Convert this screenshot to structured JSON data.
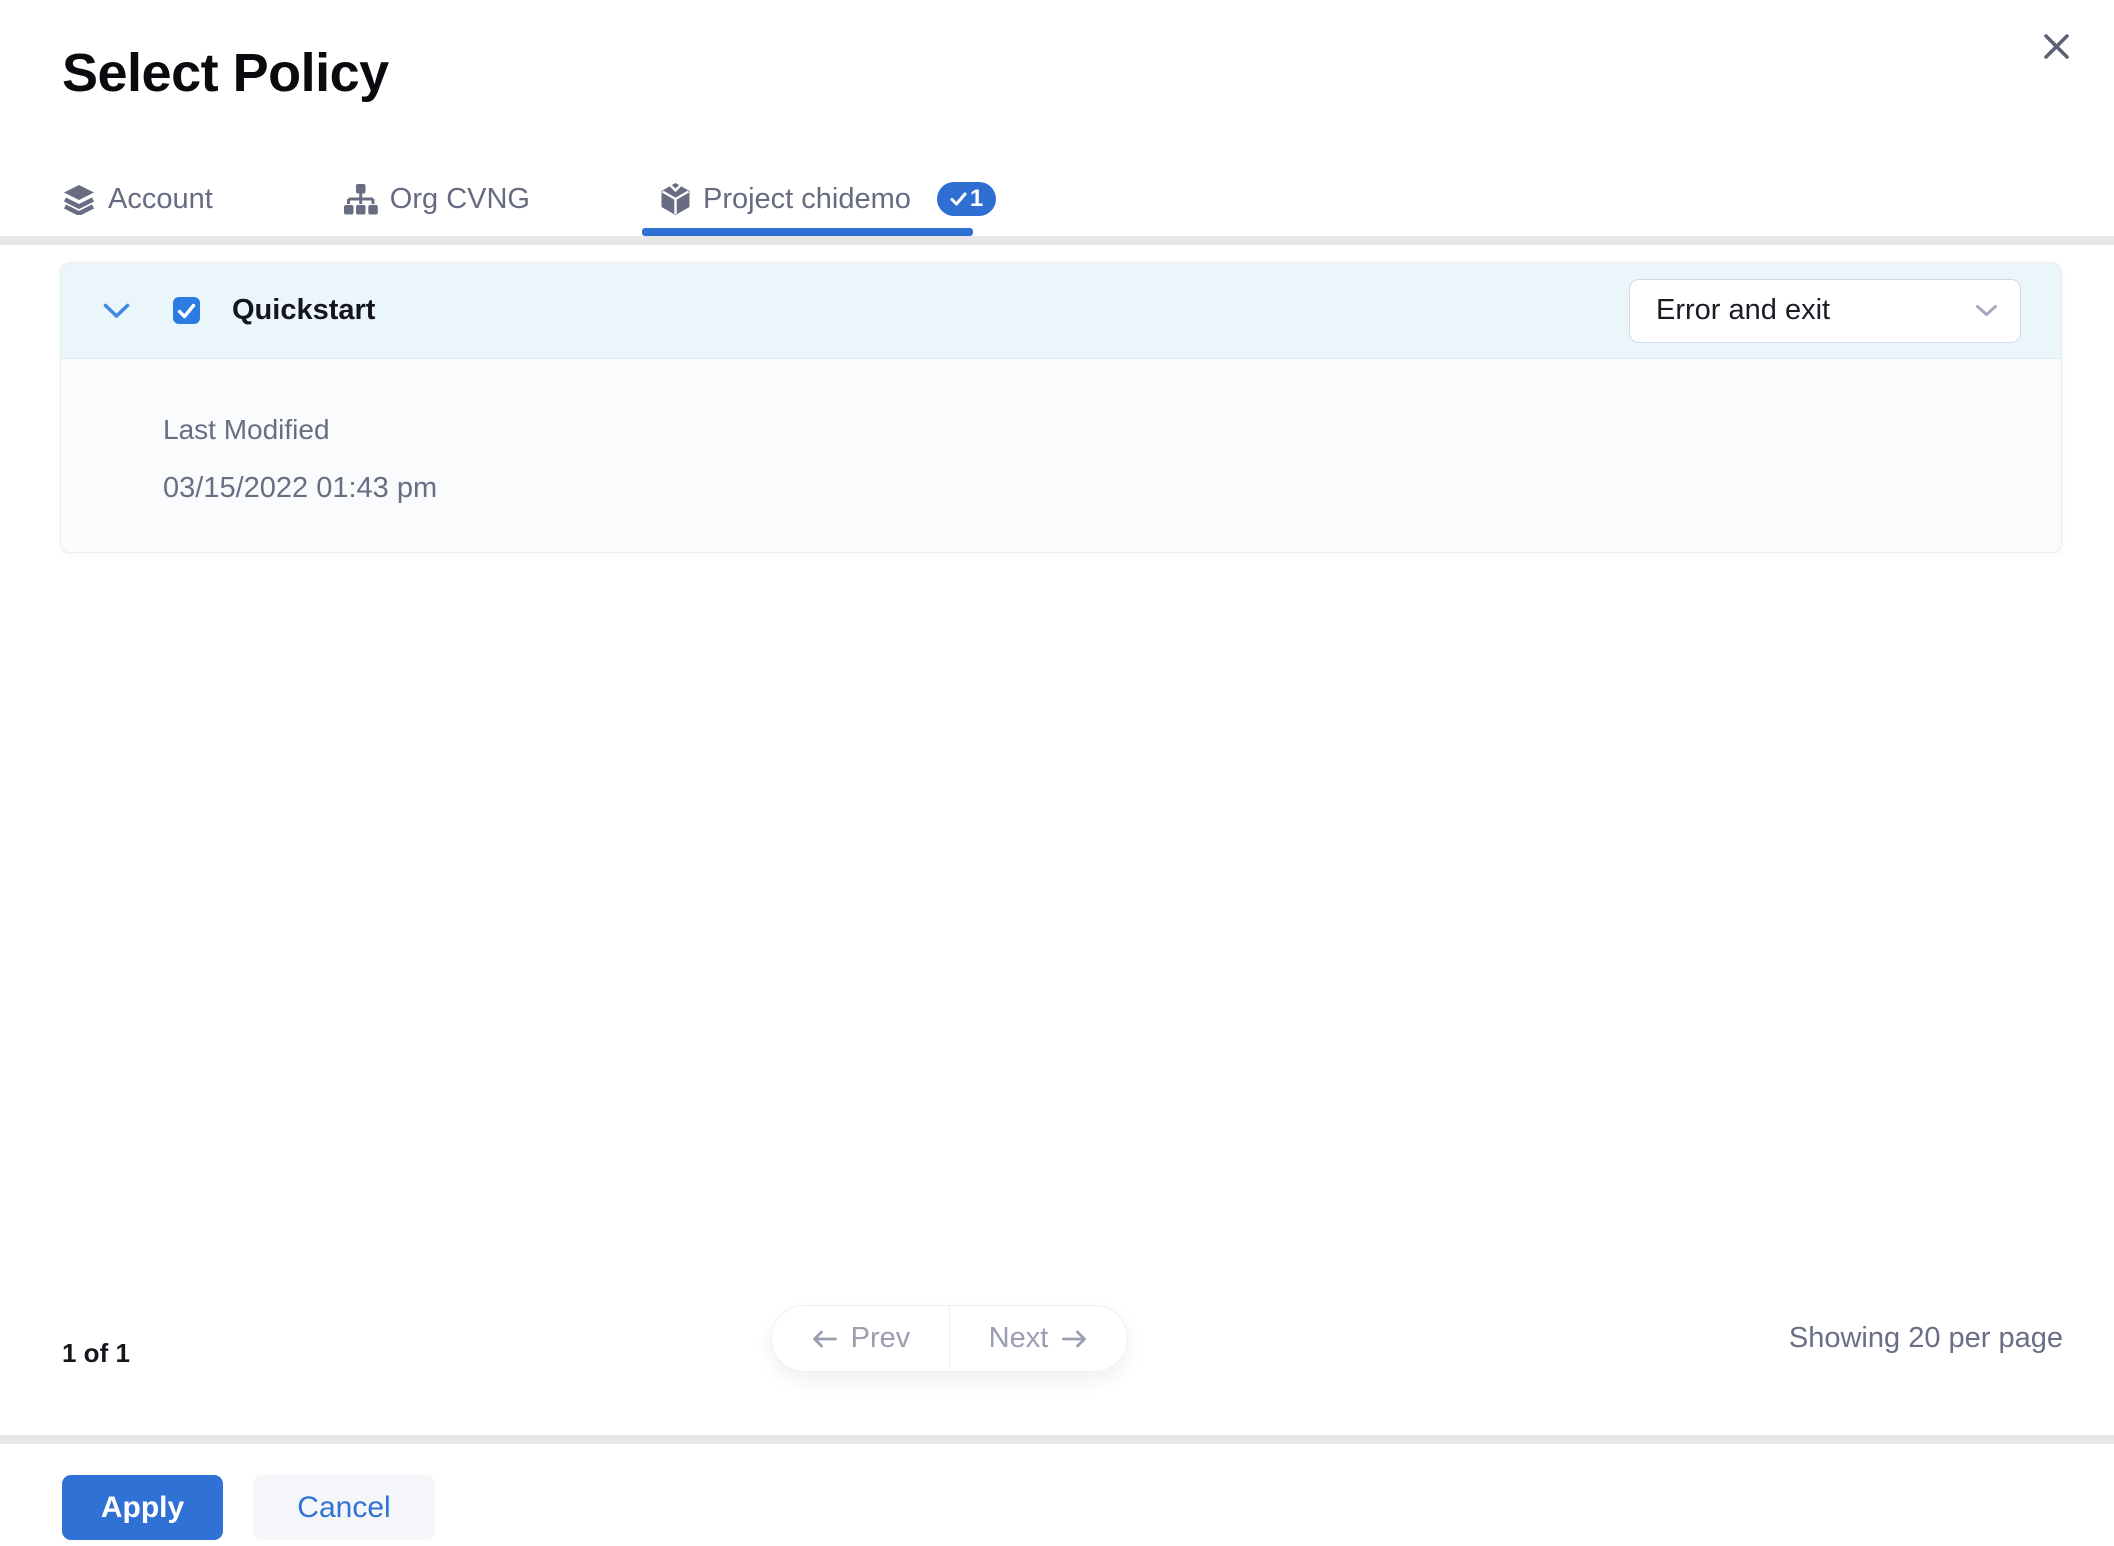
{
  "modal": {
    "title": "Select Policy"
  },
  "tabs": {
    "items": [
      {
        "label": "Account",
        "icon": "layers-icon",
        "active": false
      },
      {
        "label": "Org CVNG",
        "icon": "org-chart-icon",
        "active": false
      },
      {
        "label": "Project chidemo",
        "icon": "cube-icon",
        "active": true,
        "badge_count": "1"
      }
    ]
  },
  "policy_list": {
    "rows": [
      {
        "name": "Quickstart",
        "checked": true,
        "expanded": true,
        "action_select": {
          "value": "Error and exit"
        },
        "details": {
          "last_modified_label": "Last Modified",
          "last_modified_value": "03/15/2022 01:43 pm"
        }
      }
    ]
  },
  "pagination": {
    "page_indicator": "1 of 1",
    "prev_label": "Prev",
    "next_label": "Next",
    "per_page_text": "Showing 20 per page"
  },
  "footer": {
    "apply_label": "Apply",
    "cancel_label": "Cancel"
  },
  "icons": {
    "close": "x-mark",
    "account": "stacked-layers",
    "org": "org-chart-nodes",
    "project": "3d-cube",
    "row_expander": "chevron-down",
    "select": "chevron-down",
    "checkbox": "check",
    "badge": "check",
    "prev": "arrow-left",
    "next": "arrow-right"
  },
  "colors": {
    "primary_blue": "#2f6fd3",
    "checkbox_blue": "#2b7be2",
    "slate_text": "#6a6e83",
    "muted_text": "#9b9eb1",
    "row_header_bg": "#eaf6fa",
    "row_body_bg": "#fafbfc",
    "divider_gray": "#e7e7e8"
  }
}
